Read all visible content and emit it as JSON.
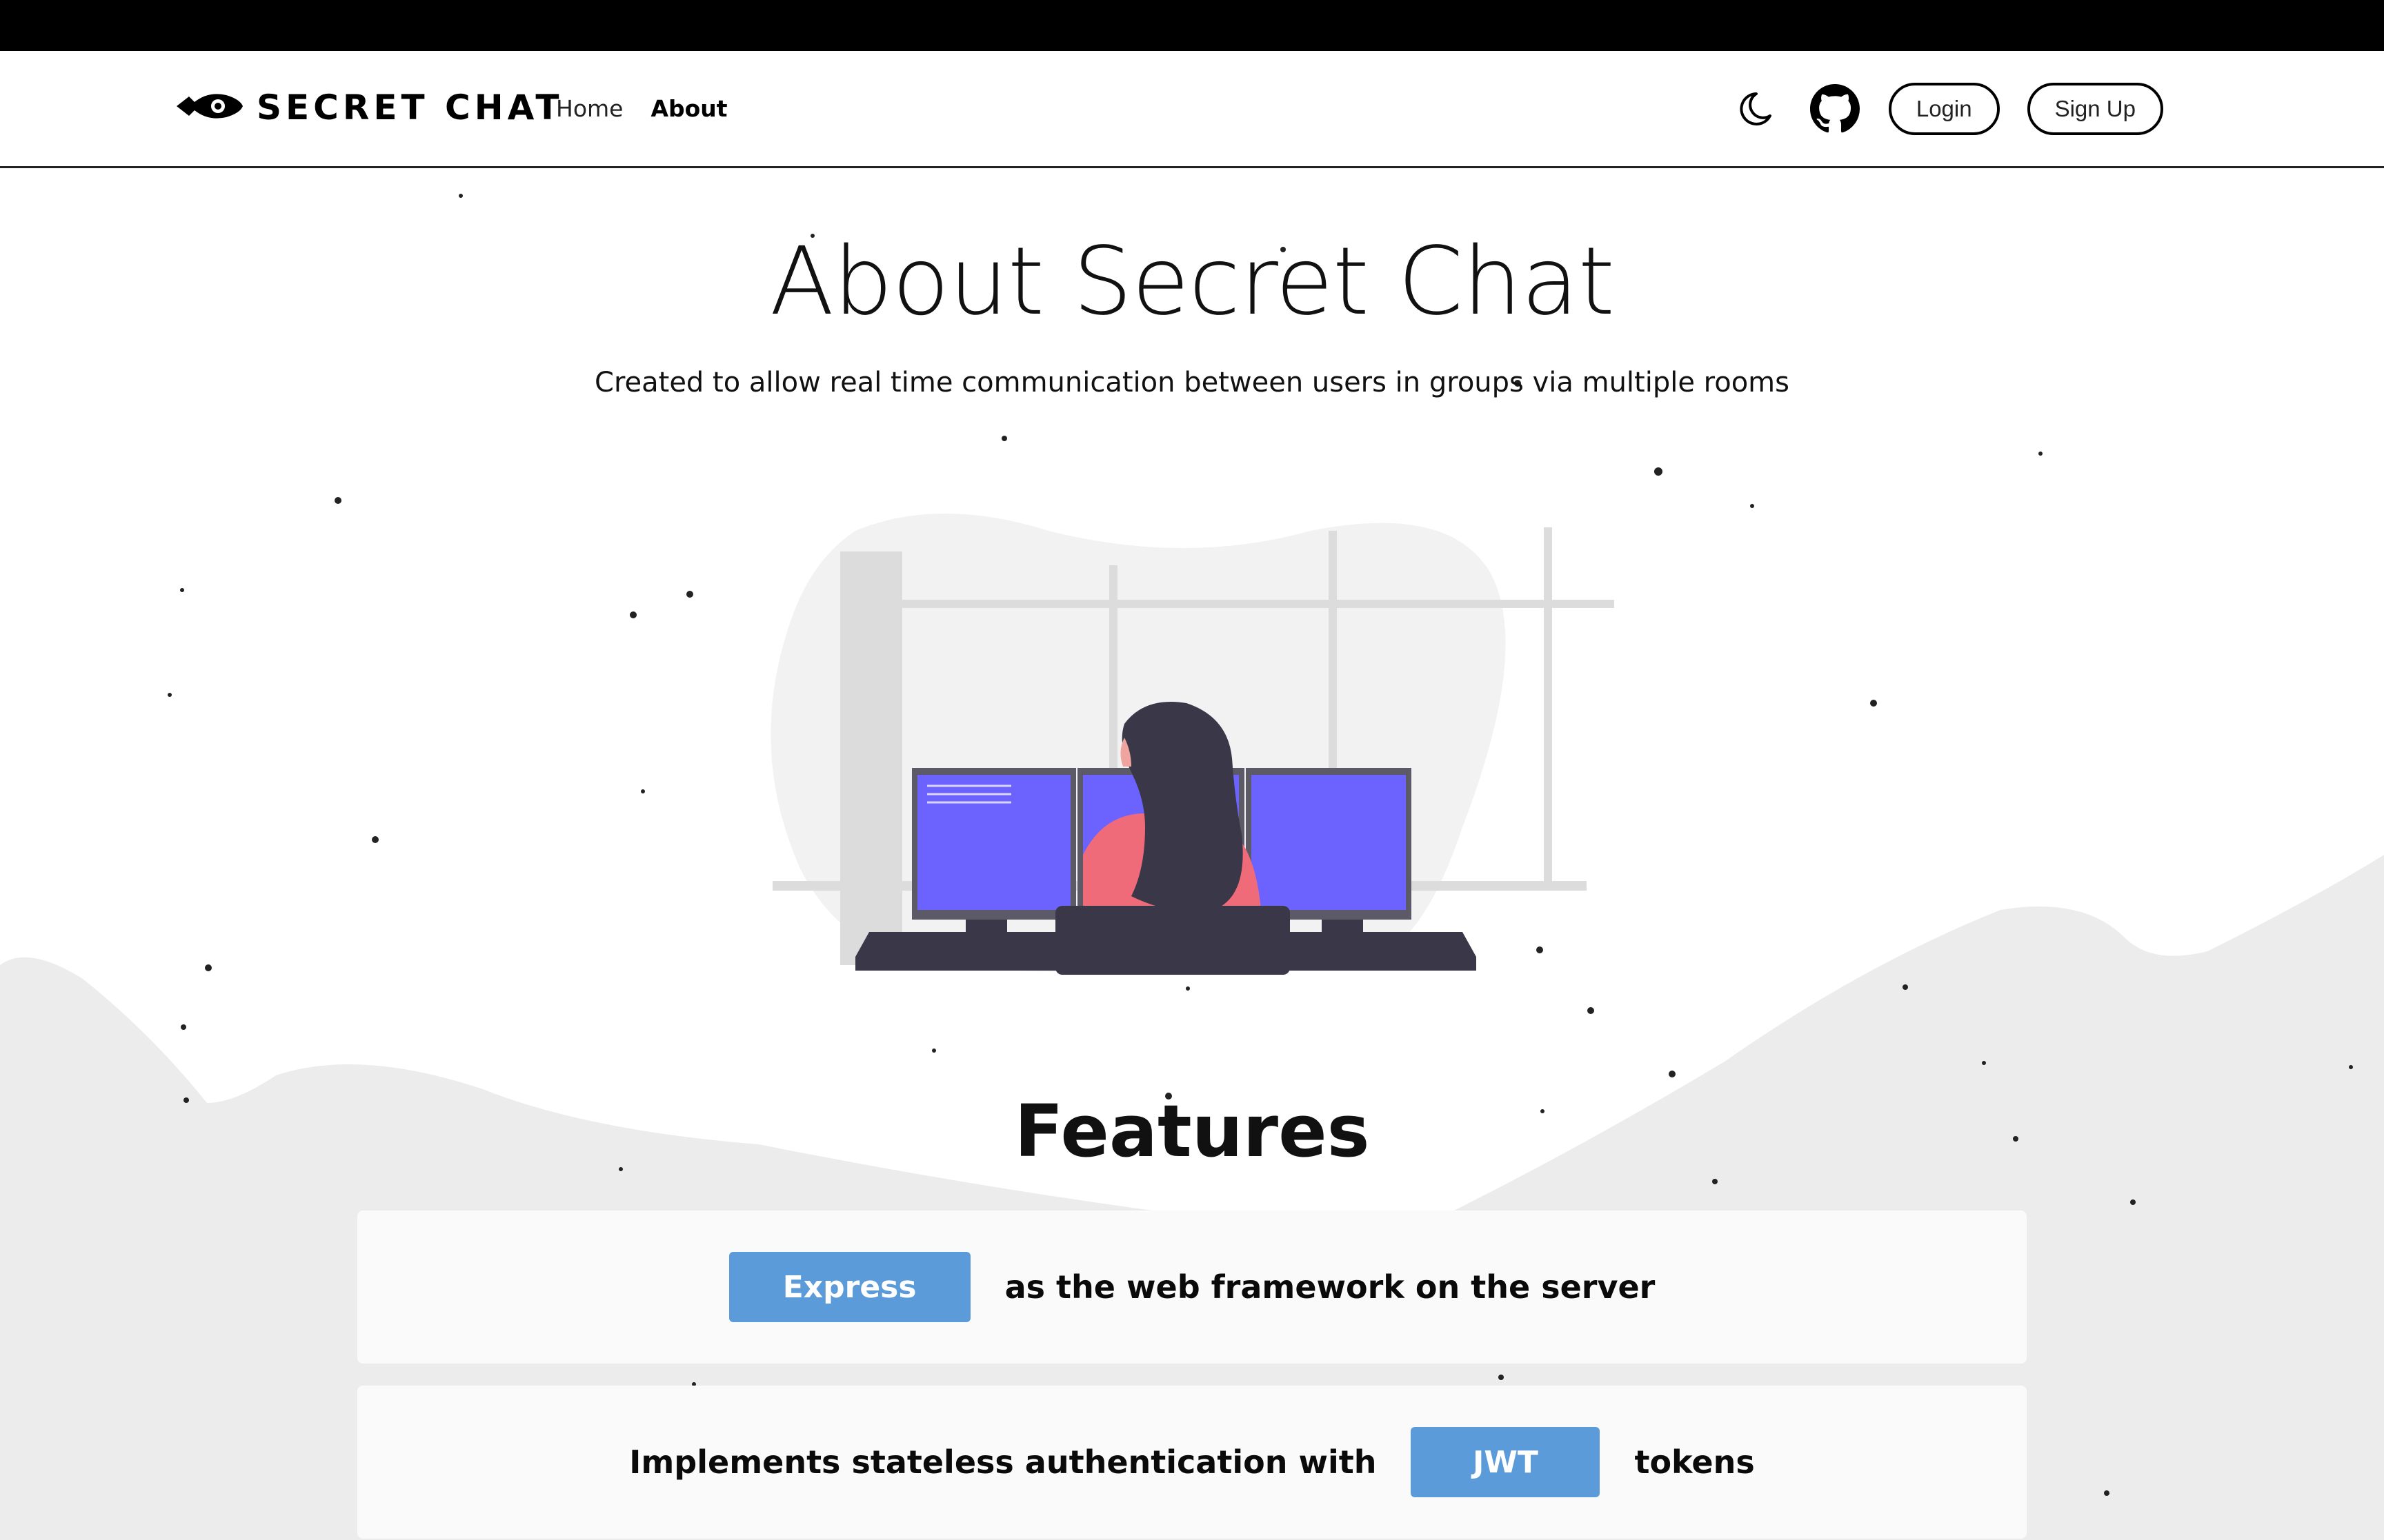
{
  "brand": {
    "name": "SECRET CHAT"
  },
  "nav": {
    "home": "Home",
    "about": "About"
  },
  "actions": {
    "login": "Login",
    "signup": "Sign Up"
  },
  "icons": {
    "logo": "rocket-icon",
    "theme": "moon-icon",
    "repo": "github-icon"
  },
  "page": {
    "title": "About Secret Chat",
    "subtitle": "Created to allow real time communication between users in groups via multiple rooms"
  },
  "features": {
    "title": "Features",
    "items": [
      {
        "tag": "Express",
        "before": "",
        "after": "as the web framework on the server"
      },
      {
        "tag": "JWT",
        "before": "Implements stateless authentication with",
        "after": "tokens"
      }
    ]
  },
  "colors": {
    "accent": "#5b9bd9",
    "monitor": "#6c63ff",
    "shirt": "#f06b7a",
    "hair": "#3a3848",
    "mountains": "#ececec"
  }
}
